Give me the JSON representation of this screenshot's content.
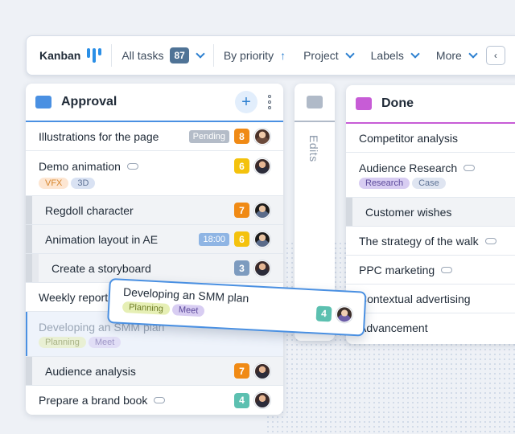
{
  "toolbar": {
    "title": "Kanban",
    "all_tasks_label": "All tasks",
    "all_tasks_count": "87",
    "sort_label": "By priority",
    "sort_arrow": "↑",
    "project_label": "Project",
    "labels_label": "Labels",
    "more_label": "More",
    "collapse_glyph": "‹",
    "logo_color": "#2b8fe6"
  },
  "columns": {
    "approval": {
      "title": "Approval",
      "color": "#4a90e2",
      "add_glyph": "+",
      "rows": [
        {
          "title": "Illustrations for the page",
          "status": "Pending",
          "priority": "8"
        },
        {
          "title": "Demo animation",
          "priority": "6",
          "tags": [
            "VFX",
            "3D"
          ]
        },
        {
          "title": "Regdoll character",
          "priority": "7"
        },
        {
          "title": "Animation layout in AE",
          "time": "18:00",
          "priority": "6"
        },
        {
          "title": "Create a storyboard",
          "priority": "3"
        },
        {
          "title": "Weekly report"
        },
        {
          "title": "Developing an SMM plan",
          "tags": [
            "Planning",
            "Meet"
          ]
        },
        {
          "title": "Audience analysis",
          "priority": "7"
        },
        {
          "title": "Prepare a brand book",
          "priority": "4"
        }
      ]
    },
    "edits": {
      "title": "Edits",
      "color": "#b0bac8"
    },
    "done": {
      "title": "Done",
      "color": "#c75cd6",
      "rows": [
        {
          "title": "Competitor analysis"
        },
        {
          "title": "Audience Research",
          "tags": [
            "Research",
            "Case"
          ]
        },
        {
          "title": "Customer wishes"
        },
        {
          "title": "The strategy of the walk"
        },
        {
          "title": "PPC marketing"
        },
        {
          "title": "Contextual advertising"
        },
        {
          "title": "Advancement"
        }
      ]
    }
  },
  "drag_card": {
    "title": "Developing an SMM plan",
    "priority": "4",
    "tags": [
      "Planning",
      "Meet"
    ]
  }
}
